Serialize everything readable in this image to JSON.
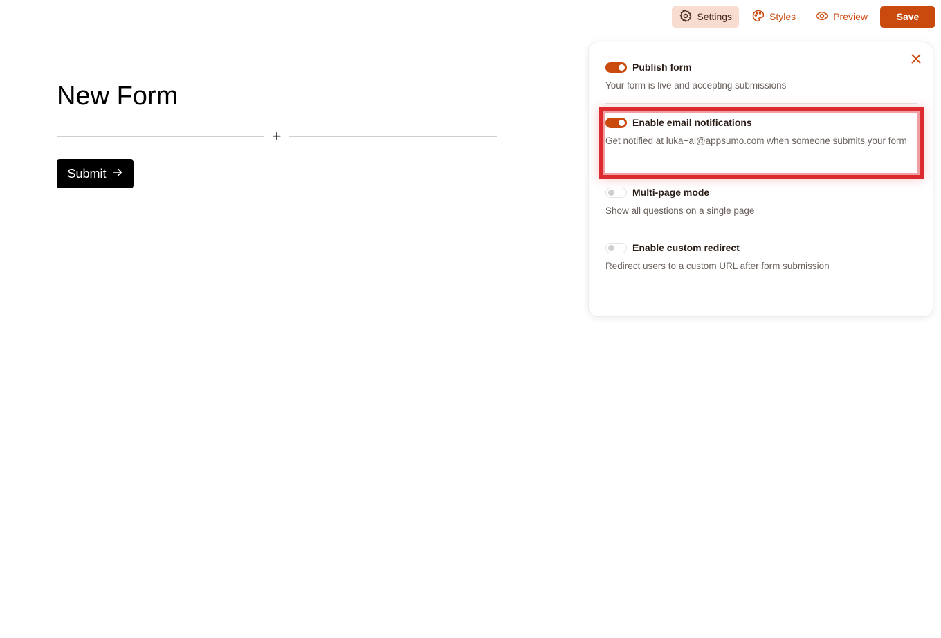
{
  "toolbar": {
    "settings_label": "Settings",
    "styles_label": "Styles",
    "preview_label": "Preview",
    "save_label": "Save"
  },
  "form": {
    "title": "New Form",
    "add_symbol": "+",
    "submit_label": "Submit"
  },
  "settings_panel": {
    "items": [
      {
        "title": "Publish form",
        "description": "Your form is live and accepting submissions",
        "enabled": true
      },
      {
        "title": "Enable email notifications",
        "description": "Get notified at luka+ai@appsumo.com when someone submits your form",
        "enabled": true
      },
      {
        "title": "Multi-page mode",
        "description": "Show all questions on a single page",
        "enabled": false
      },
      {
        "title": "Enable custom redirect",
        "description": "Redirect users to a custom URL after form submission",
        "enabled": false
      }
    ]
  },
  "colors": {
    "accent": "#c94a0c",
    "active_tab_bg": "#f7dccf",
    "highlight": "#dc2a2f"
  },
  "icons": [
    "gear-icon",
    "palette-icon",
    "eye-icon",
    "plus-icon",
    "arrow-right-icon",
    "close-icon"
  ]
}
